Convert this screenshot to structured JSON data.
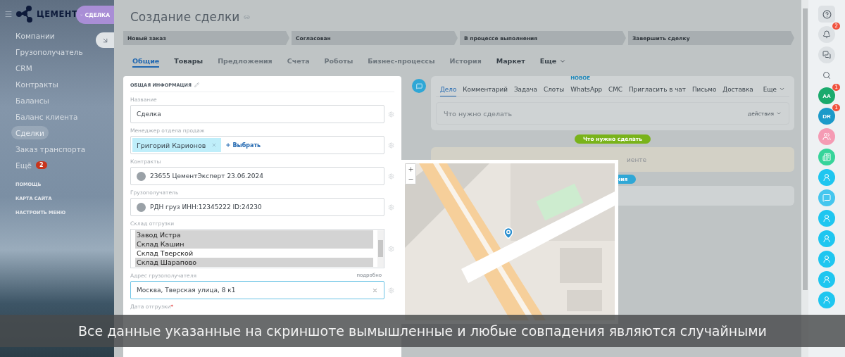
{
  "sidebar": {
    "logo": "ЦЕМЕНТ",
    "slider_tag": "СДЕЛКА",
    "items": [
      {
        "label": "Компании",
        "selected": false
      },
      {
        "label": "Грузополучатель",
        "selected": false
      },
      {
        "label": "CRM",
        "selected": false
      },
      {
        "label": "Контракты",
        "selected": false
      },
      {
        "label": "Балансы",
        "selected": false
      },
      {
        "label": "Баланс клиента",
        "selected": false
      },
      {
        "label": "Сделки",
        "selected": true
      },
      {
        "label": "Заказ транспорта",
        "selected": false
      },
      {
        "label": "Ещё",
        "selected": false,
        "badge": "2"
      }
    ],
    "footer_links": [
      "ПОМОЩЬ",
      "КАРТА САЙТА",
      "НАСТРОИТЬ МЕНЮ"
    ]
  },
  "page": {
    "title": "Создание сделки",
    "stages": [
      "Новый заказ",
      "Согласован",
      "В процессе выполнения",
      "Завершить сделку"
    ],
    "tabs": [
      {
        "label": "Общие",
        "selected": true,
        "disabled": false
      },
      {
        "label": "Товары",
        "selected": false,
        "disabled": false
      },
      {
        "label": "Предложения",
        "selected": false,
        "disabled": true
      },
      {
        "label": "Счета",
        "selected": false,
        "disabled": true
      },
      {
        "label": "Роботы",
        "selected": false,
        "disabled": true
      },
      {
        "label": "Бизнес-процессы",
        "selected": false,
        "disabled": true
      },
      {
        "label": "История",
        "selected": false,
        "disabled": true
      },
      {
        "label": "Маркет",
        "selected": false,
        "disabled": false
      },
      {
        "label": "Еще",
        "selected": false,
        "disabled": false
      }
    ]
  },
  "form": {
    "title": "ОБЩАЯ ИНФОРМАЦИЯ",
    "fields": [
      {
        "kind": "text",
        "label": "Название",
        "value": "Сделка"
      },
      {
        "kind": "user",
        "label": "Менеджер отдела продаж",
        "user": "Григорий Карионов",
        "action": "Выбрать"
      },
      {
        "kind": "entity",
        "label": "Контракты",
        "value": "23655 ЦементЭксперт 23.06.2024"
      },
      {
        "kind": "entity",
        "label": "Грузополучатель",
        "value": "РДН груз ИНН:12345222 ID:24230"
      },
      {
        "kind": "multiselect",
        "label": "Склад отгрузки",
        "options": [
          {
            "label": "Завод Истра",
            "selected": true
          },
          {
            "label": "Склад Кашин",
            "selected": true
          },
          {
            "label": "Склад Тверской",
            "selected": false
          },
          {
            "label": "Склад Шарапово",
            "selected": true
          }
        ]
      },
      {
        "kind": "address",
        "label": "Адрес грузополучателя",
        "link": "подробно",
        "value": "Москва, Тверская улица, 8 к1"
      },
      {
        "kind": "date",
        "label": "Дата отгрузки",
        "required_mark": "*"
      }
    ]
  },
  "timeline": {
    "tabs": [
      {
        "label": "Дело",
        "selected": true
      },
      {
        "label": "Комментарий",
        "selected": false
      },
      {
        "label": "Задача",
        "selected": false
      },
      {
        "label": "Слоты",
        "selected": false
      },
      {
        "label": "WhatsApp",
        "selected": false,
        "badge": "НОВОЕ"
      },
      {
        "label": "СМС",
        "selected": false
      },
      {
        "label": "Пригласить в чат",
        "selected": false
      },
      {
        "label": "Письмо",
        "selected": false
      },
      {
        "label": "Доставка",
        "selected": false
      },
      {
        "label": "Еще",
        "selected": false
      }
    ],
    "placeholder": "Что нужно сделать",
    "actions": "действия",
    "pills": [
      {
        "label": "Что нужно сделать",
        "color": "#79b31a"
      },
      {
        "label": "ния",
        "color": "#2fa7d6"
      }
    ],
    "note_fragment": "иенте"
  },
  "right_bar": [
    {
      "kind": "help"
    },
    {
      "kind": "bell",
      "badge": "2"
    },
    {
      "kind": "chat"
    },
    {
      "kind": "search"
    },
    {
      "kind": "avatar",
      "initials": "AA",
      "color": "#1aaa6c",
      "badge": "1"
    },
    {
      "kind": "avatar",
      "initials": "DR",
      "color": "#1c9ac9",
      "badge": "1"
    },
    {
      "kind": "group",
      "color": "#f59bb4"
    },
    {
      "kind": "news",
      "color": "#36d49a"
    },
    {
      "kind": "contact",
      "color": "#1ec6f0"
    },
    {
      "kind": "message",
      "color": "#45c6ee"
    },
    {
      "kind": "contact",
      "color": "#1ec6f0"
    },
    {
      "kind": "contact",
      "color": "#1ec6f0"
    },
    {
      "kind": "contact",
      "color": "#1ec6f0"
    },
    {
      "kind": "contact",
      "color": "#1ec6f0"
    },
    {
      "kind": "contact",
      "color": "#1ec6f0"
    }
  ],
  "caption": "Все данные указанные на скриншоте вымышленные и любые совпадения являются случайными"
}
